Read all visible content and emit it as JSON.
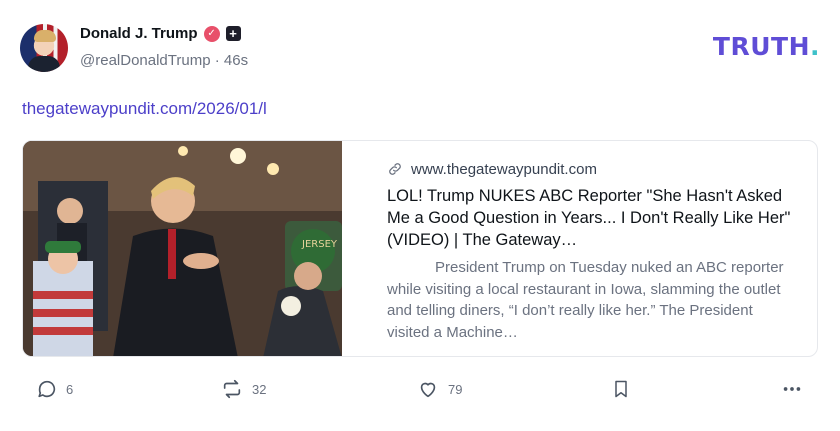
{
  "header": {
    "display_name": "Donald J. Trump",
    "handle": "@realDonaldTrump",
    "separator": "·",
    "time": "46s",
    "logo_text": "TRUTH",
    "logo_dot": "."
  },
  "post": {
    "link_text": "thegatewaypundit.com/2026/01/l"
  },
  "card": {
    "domain": "www.thegatewaypundit.com",
    "title": "LOL! Trump NUKES ABC Reporter \"She Hasn't Asked Me a Good Question in Years... I Don't Really Like Her\" (VIDEO) | The Gateway…",
    "description": "President Trump on Tuesday nuked an ABC reporter while visiting a local restaurant in Iowa, slamming the outlet and telling diners, “I don’t really like her.” The President visited a Machine…",
    "image_sign_text": "JERSEY"
  },
  "actions": {
    "replies": "6",
    "retruths": "32",
    "likes": "79"
  },
  "icons": {
    "verified": "verified-badge-icon",
    "plus": "plus-badge-icon",
    "link": "link-icon",
    "reply": "reply-bubble-icon",
    "retruth": "retruth-icon",
    "like": "heart-icon",
    "save": "bookmark-icon",
    "more": "more-dots-icon"
  },
  "colors": {
    "brand_purple": "#5f4dd6",
    "brand_teal": "#3ec1c9",
    "link": "#4c3fc9",
    "muted": "#6b7280",
    "verified": "#e8506a"
  }
}
